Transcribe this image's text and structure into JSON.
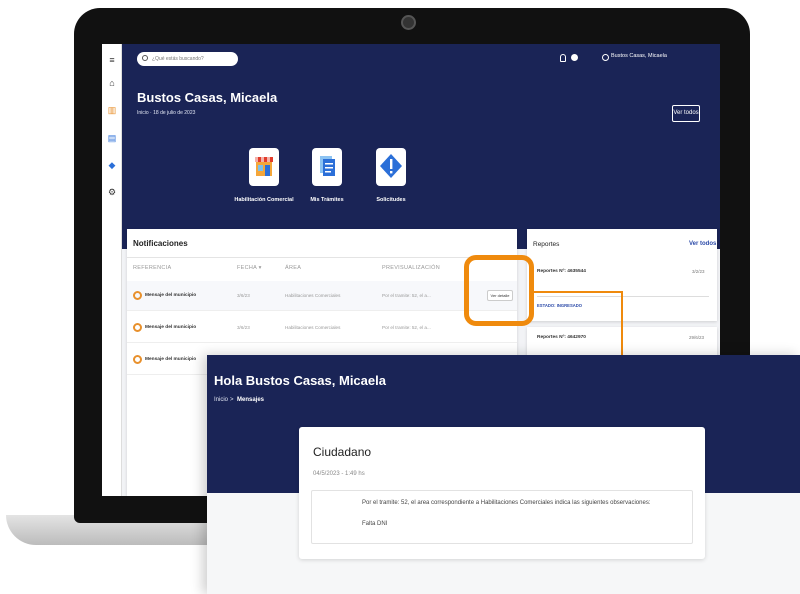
{
  "app": {
    "search_placeholder": "¿Qué estás buscando?",
    "user_name": "Bustos Casas, Micaela",
    "title": "Bustos Casas, Micaela",
    "subtitle": "Inicio · 18 de julio de 2023",
    "ver_todos_button": "Ver todos",
    "tiles": [
      {
        "label": "Habilitación Comercial",
        "icon": "storefront-icon"
      },
      {
        "label": "Mis Trámites",
        "icon": "documents-icon"
      },
      {
        "label": "Solicitudes",
        "icon": "alert-icon"
      }
    ]
  },
  "notifications": {
    "title": "Notificaciones",
    "columns": [
      "REFERENCIA",
      "FECHA ▾",
      "ÁREA",
      "PREVISUALIZACIÓN"
    ],
    "rows": [
      {
        "ref": "Mensaje del municipio",
        "fecha": "3/6/23",
        "area": "Habilitaciones Comerciales",
        "prev": "Por el tramite: 52, el a...",
        "action": "Ver detalle"
      },
      {
        "ref": "Mensaje del municipio",
        "fecha": "3/6/23",
        "area": "Habilitaciones Comerciales",
        "prev": "Por el tramite: 52, el a...",
        "action": ""
      },
      {
        "ref": "Mensaje del municipio",
        "fecha": "",
        "area": "",
        "prev": "",
        "action": ""
      }
    ]
  },
  "reports": {
    "title": "Reportes",
    "all_link": "Ver todos",
    "items": [
      {
        "label": "Reportes Nº: 4635544",
        "date": "3/2/23",
        "status": "ESTADO: INGRESADO"
      },
      {
        "label": "Reportes Nº: 4642970",
        "date": "29/6/23"
      }
    ]
  },
  "popup": {
    "title": "Hola Bustos Casas, Micaela",
    "breadcrumb_home": "Inicio",
    "breadcrumb_sep": ">",
    "breadcrumb_current": "Mensajes",
    "card_title": "Ciudadano",
    "card_date": "04/5/2023 - 1:49 hs",
    "message": "Por el tramite: 52, el area correspondiente a Habilitaciones Comerciales indica las siguientes observaciones:",
    "note": "Falta DNI"
  },
  "colors": {
    "navy": "#1a2456",
    "accent_orange": "#ef8a0d",
    "link_blue": "#2b4aa8"
  }
}
